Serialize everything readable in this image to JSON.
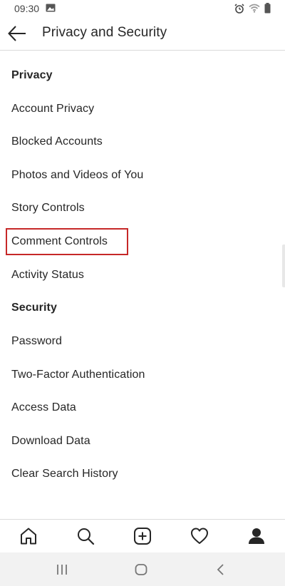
{
  "status_bar": {
    "time": "09:30",
    "icons": [
      "gallery-icon",
      "alarm-icon",
      "wifi-icon",
      "battery-icon"
    ]
  },
  "header": {
    "title": "Privacy and Security",
    "back_icon": "arrow-left-icon"
  },
  "sections": [
    {
      "heading": "Privacy",
      "items": [
        "Account Privacy",
        "Blocked Accounts",
        "Photos and Videos of You",
        "Story Controls",
        "Comment Controls",
        "Activity Status"
      ]
    },
    {
      "heading": "Security",
      "items": [
        "Password",
        "Two-Factor Authentication",
        "Access Data",
        "Download Data",
        "Clear Search History"
      ]
    }
  ],
  "highlighted_item": "Comment Controls",
  "highlight_color": "#c62828",
  "tab_bar": {
    "tabs": [
      "home-icon",
      "search-icon",
      "new-post-icon",
      "activity-heart-icon",
      "profile-icon"
    ],
    "active": "profile-icon"
  },
  "system_nav": {
    "buttons": [
      "recents-icon",
      "home-circle-icon",
      "back-chevron-icon"
    ]
  }
}
